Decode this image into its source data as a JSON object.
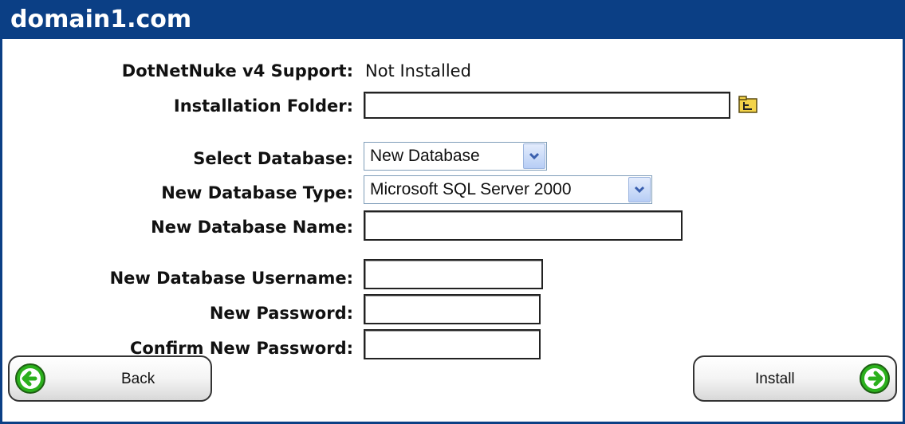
{
  "header": {
    "title": "domain1.com"
  },
  "form": {
    "dnn_label": "DotNetNuke v4 Support:",
    "dnn_value": "Not Installed",
    "folder_label": "Installation Folder:",
    "folder_value": "",
    "select_db_label": "Select Database:",
    "select_db_value": "New Database",
    "db_type_label": "New Database Type:",
    "db_type_value": "Microsoft SQL Server 2000",
    "db_name_label": "New Database Name:",
    "db_name_value": "",
    "db_user_label": "New Database Username:",
    "db_user_value": "",
    "password_label": "New Password:",
    "password_value": "",
    "confirm_label": "Confirm New Password:",
    "confirm_value": ""
  },
  "buttons": {
    "back": "Back",
    "install": "Install"
  },
  "icons": {
    "folder": "folder-browse-icon",
    "back": "arrow-left-circle-icon",
    "install": "arrow-right-circle-icon"
  },
  "colors": {
    "accent": "#0b3f85",
    "go_green": "#2bb01c"
  }
}
